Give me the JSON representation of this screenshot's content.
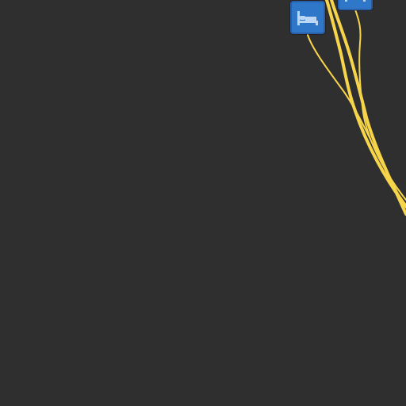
{
  "map": {
    "background_color": "#2f2f2f",
    "route_color": "#f7d54a",
    "markers": [
      {
        "type": "lodging",
        "icon": "bed-icon",
        "color": "#2f78c9"
      },
      {
        "type": "lodging",
        "icon": "bed-icon",
        "color": "#2f78c9"
      }
    ],
    "routes": [
      {
        "kind": "road"
      },
      {
        "kind": "road"
      },
      {
        "kind": "road"
      },
      {
        "kind": "road"
      }
    ]
  }
}
